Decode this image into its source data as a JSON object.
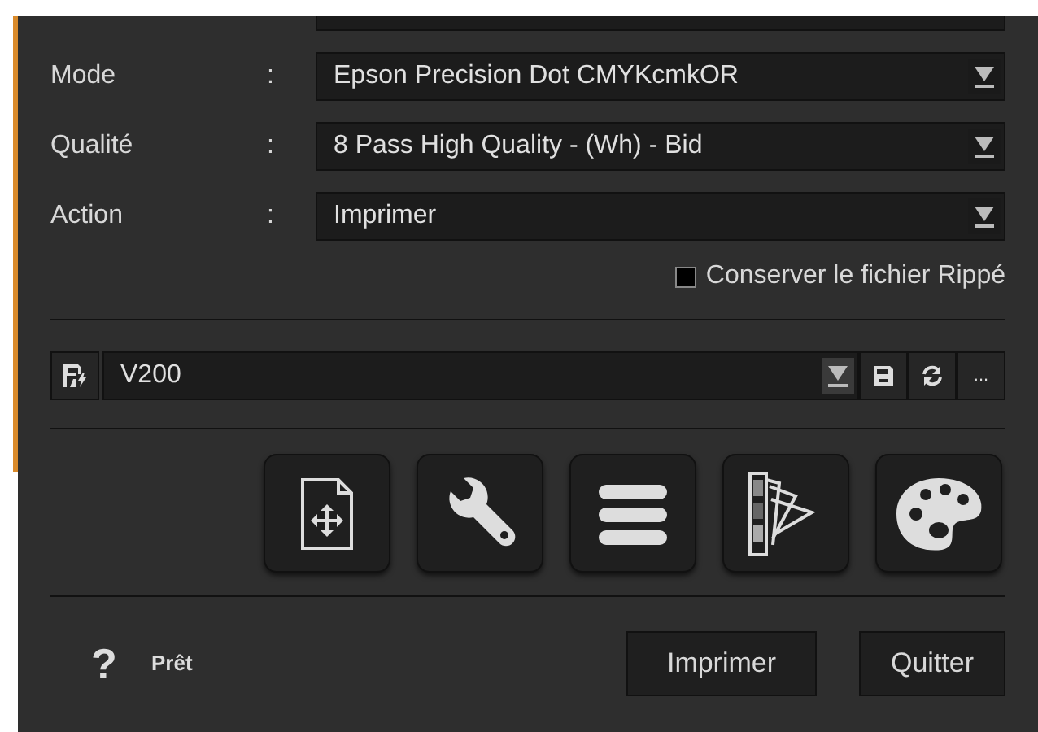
{
  "fields": [
    {
      "label": "Mode",
      "separator": ":",
      "value": "Epson Precision Dot CMYKcmkOR"
    },
    {
      "label": "Qualité",
      "separator": ":",
      "value": "8 Pass High Quality - (Wh) - Bid"
    },
    {
      "label": "Action",
      "separator": ":",
      "value": "Imprimer"
    }
  ],
  "keep_ripped_file": {
    "label": "Conserver le fichier Rippé",
    "checked": false
  },
  "profile": {
    "value": "V200",
    "more_label": "..."
  },
  "tool_buttons": [
    {
      "kind": "layout"
    },
    {
      "kind": "settings"
    },
    {
      "kind": "list"
    },
    {
      "kind": "swatches"
    },
    {
      "kind": "palette"
    }
  ],
  "footer": {
    "help": "?",
    "status": "Prêt",
    "buttons": [
      "Imprimer",
      "Quitter"
    ]
  }
}
